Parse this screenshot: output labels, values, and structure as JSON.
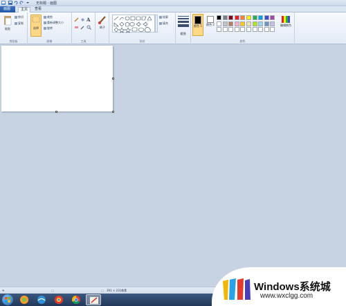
{
  "window": {
    "title": "无标题 - 画图"
  },
  "tabs": {
    "file": "画图",
    "home": "主页",
    "view": "查看"
  },
  "ribbon": {
    "clipboard": {
      "label": "剪贴板",
      "paste": "粘贴",
      "cut": "剪切",
      "copy": "复制"
    },
    "image": {
      "label": "图像",
      "select": "选择",
      "crop": "裁剪",
      "resize": "重新调整大小",
      "rotate": "旋转"
    },
    "tools": {
      "label": "工具",
      "brush": "刷子"
    },
    "shapes": {
      "label": "形状",
      "outline": "轮廓",
      "fill": "填充"
    },
    "size": {
      "label": "粗细"
    },
    "colors": {
      "label": "颜色",
      "color1": "颜色 1",
      "color2": "颜色 2",
      "edit": "编辑颜色"
    }
  },
  "palette": {
    "row1": [
      "#000000",
      "#7f7f7f",
      "#880015",
      "#ed1c24",
      "#ff7f27",
      "#fff200",
      "#22b14c",
      "#00a2e8",
      "#3f48cc",
      "#a349a4"
    ],
    "row2": [
      "#ffffff",
      "#c3c3c3",
      "#b97a57",
      "#ffaec9",
      "#ffc90e",
      "#efe4b0",
      "#b5e61d",
      "#99d9ea",
      "#7092be",
      "#c8bfe7"
    ],
    "row3": [
      "#ffffff",
      "#ffffff",
      "#ffffff",
      "#ffffff",
      "#ffffff",
      "#ffffff",
      "#ffffff",
      "#ffffff",
      "#ffffff",
      "#ffffff"
    ]
  },
  "status": {
    "canvas_size": "391 × 231像素"
  },
  "watermark": {
    "title": "Windows系统城",
    "url": "www.wxclgg.com"
  },
  "colors": {
    "accent": "#2256a6",
    "selected_tool": "#ffd888"
  }
}
